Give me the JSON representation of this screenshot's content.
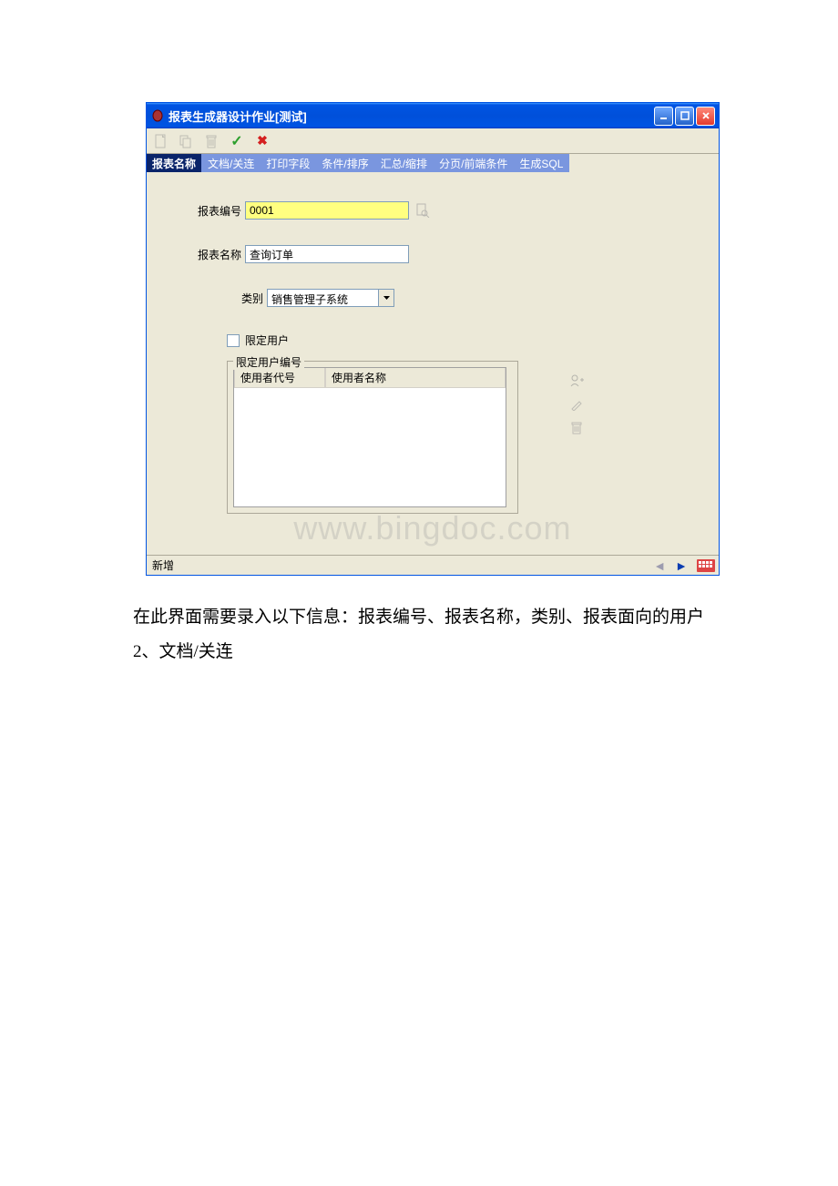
{
  "window": {
    "title": "报表生成器设计作业[测试]"
  },
  "tabs": [
    {
      "label": "报表名称",
      "active": true
    },
    {
      "label": "文档/关连",
      "active": false
    },
    {
      "label": "打印字段",
      "active": false
    },
    {
      "label": "条件/排序",
      "active": false
    },
    {
      "label": "汇总/缩排",
      "active": false
    },
    {
      "label": "分页/前端条件",
      "active": false
    },
    {
      "label": "生成SQL",
      "active": false
    }
  ],
  "form": {
    "reportId": {
      "label": "报表编号",
      "value": "0001"
    },
    "reportName": {
      "label": "报表名称",
      "value": "查询订单"
    },
    "category": {
      "label": "类别",
      "value": "销售管理子系统"
    },
    "restrictUser": {
      "label": "限定用户"
    },
    "restrictGroup": {
      "legend": "限定用户编号",
      "col1": "使用者代号",
      "col2": "使用者名称"
    }
  },
  "statusbar": {
    "text": "新增"
  },
  "watermark": "www.bingdoc.com",
  "doc": {
    "p1": "在此界面需要录入以下信息：报表编号、报表名称，类别、报表面向的用户",
    "p2": "2、文档/关连"
  }
}
